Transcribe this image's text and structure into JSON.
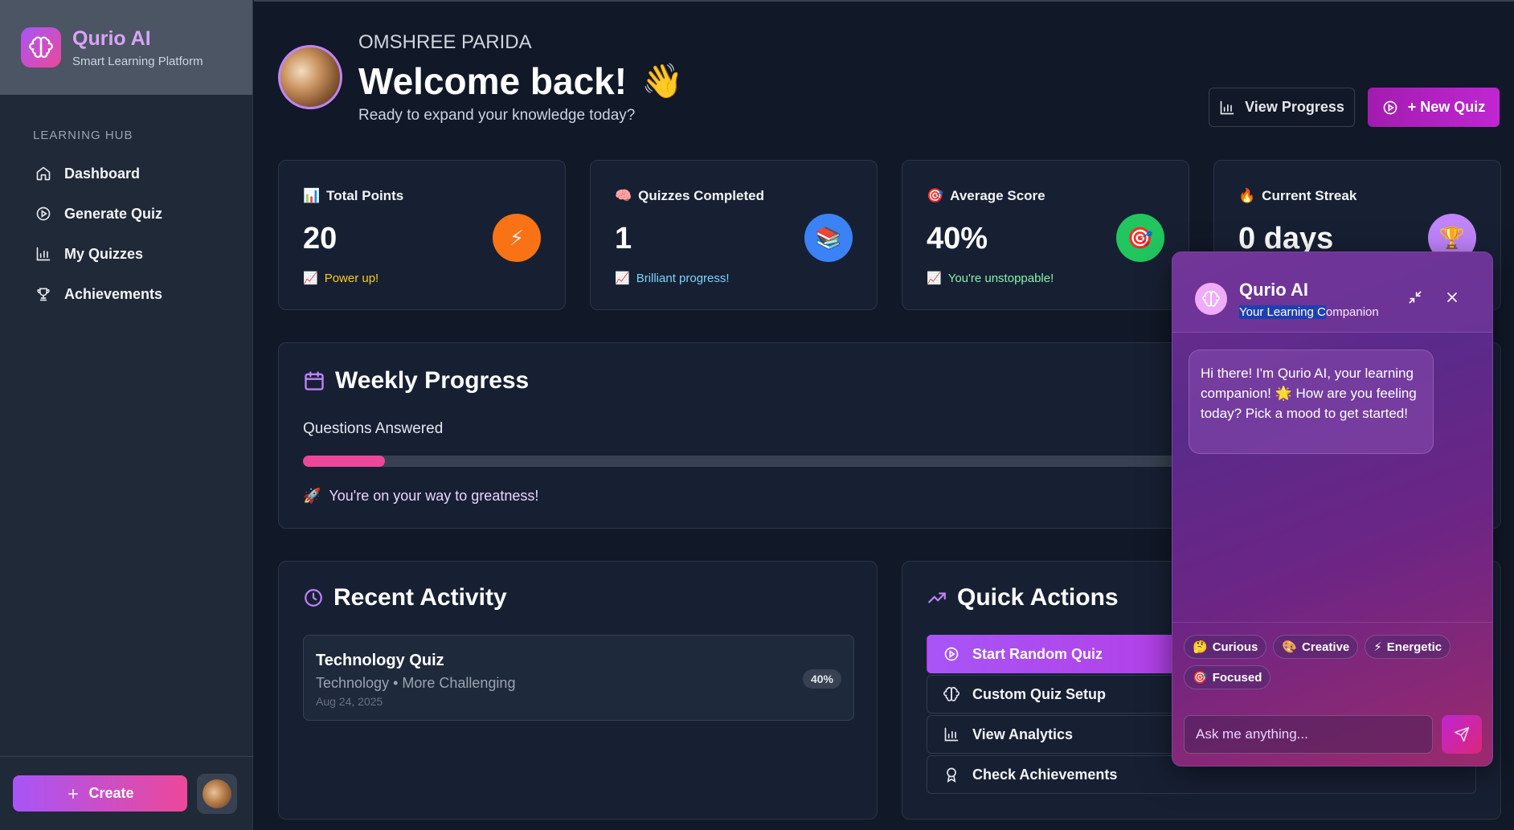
{
  "sidebar": {
    "brand_name": "Qurio AI",
    "brand_sub": "Smart Learning Platform",
    "section_title": "LEARNING HUB",
    "items": [
      {
        "label": "Dashboard",
        "icon": "home-icon"
      },
      {
        "label": "Generate Quiz",
        "icon": "play-circle-icon"
      },
      {
        "label": "My Quizzes",
        "icon": "bar-chart-icon"
      },
      {
        "label": "Achievements",
        "icon": "trophy-icon"
      }
    ],
    "create_label": "Create"
  },
  "header": {
    "username": "OMSHREE PARIDA",
    "welcome": "Welcome back!",
    "wave_emoji": "👋",
    "tagline": "Ready to expand your knowledge today?",
    "view_progress_label": "View Progress",
    "new_quiz_label": "+ New Quiz"
  },
  "stats": [
    {
      "title": "Total Points",
      "emoji": "📊",
      "value": "20",
      "note": "Power up!",
      "note_color": "#facc15",
      "icon_emoji": "⚡",
      "icon_bg": "#f97316"
    },
    {
      "title": "Quizzes Completed",
      "emoji": "🧠",
      "value": "1",
      "note": "Brilliant progress!",
      "note_color": "#7dd3fc",
      "icon_emoji": "📚",
      "icon_bg": "#3b82f6"
    },
    {
      "title": "Average Score",
      "emoji": "🎯",
      "value": "40%",
      "note": "You're unstoppable!",
      "note_color": "#86efac",
      "icon_emoji": "🎯",
      "icon_bg": "#22c55e"
    },
    {
      "title": "Current Streak",
      "emoji": "🔥",
      "value": "0 days",
      "note": "",
      "note_color": "#fde68a",
      "icon_emoji": "🏆",
      "icon_bg": "#c084fc"
    }
  ],
  "weekly": {
    "title": "Weekly Progress",
    "label": "Questions Answered",
    "progress_fraction": 0.07,
    "note": "You're on your way to greatness!",
    "note_emoji": "🚀"
  },
  "recent": {
    "title": "Recent Activity",
    "items": [
      {
        "title": "Technology Quiz",
        "sub": "Technology • More Challenging",
        "date": "Aug 24, 2025",
        "score": "40%"
      }
    ]
  },
  "quick_actions": {
    "title": "Quick Actions",
    "items": [
      {
        "label": "Start Random Quiz",
        "icon": "play-circle-icon"
      },
      {
        "label": "Custom Quiz Setup",
        "icon": "brain-icon"
      },
      {
        "label": "View Analytics",
        "icon": "bar-chart-icon"
      },
      {
        "label": "Check Achievements",
        "icon": "award-icon"
      }
    ]
  },
  "chat": {
    "name": "Qurio AI",
    "sub_selected": "Your Learning C",
    "sub_rest": "ompanion",
    "message": "Hi there! I'm Qurio AI, your learning companion! 🌟 How are you feeling today? Pick a mood to get started!",
    "moods": [
      {
        "emoji": "🤔",
        "label": "Curious"
      },
      {
        "emoji": "🎨",
        "label": "Creative"
      },
      {
        "emoji": "⚡",
        "label": "Energetic"
      },
      {
        "emoji": "🎯",
        "label": "Focused"
      }
    ],
    "input_placeholder": "Ask me anything..."
  },
  "colors": {
    "accent": "#a855f7",
    "pink": "#ec4899",
    "background": "#111827"
  }
}
